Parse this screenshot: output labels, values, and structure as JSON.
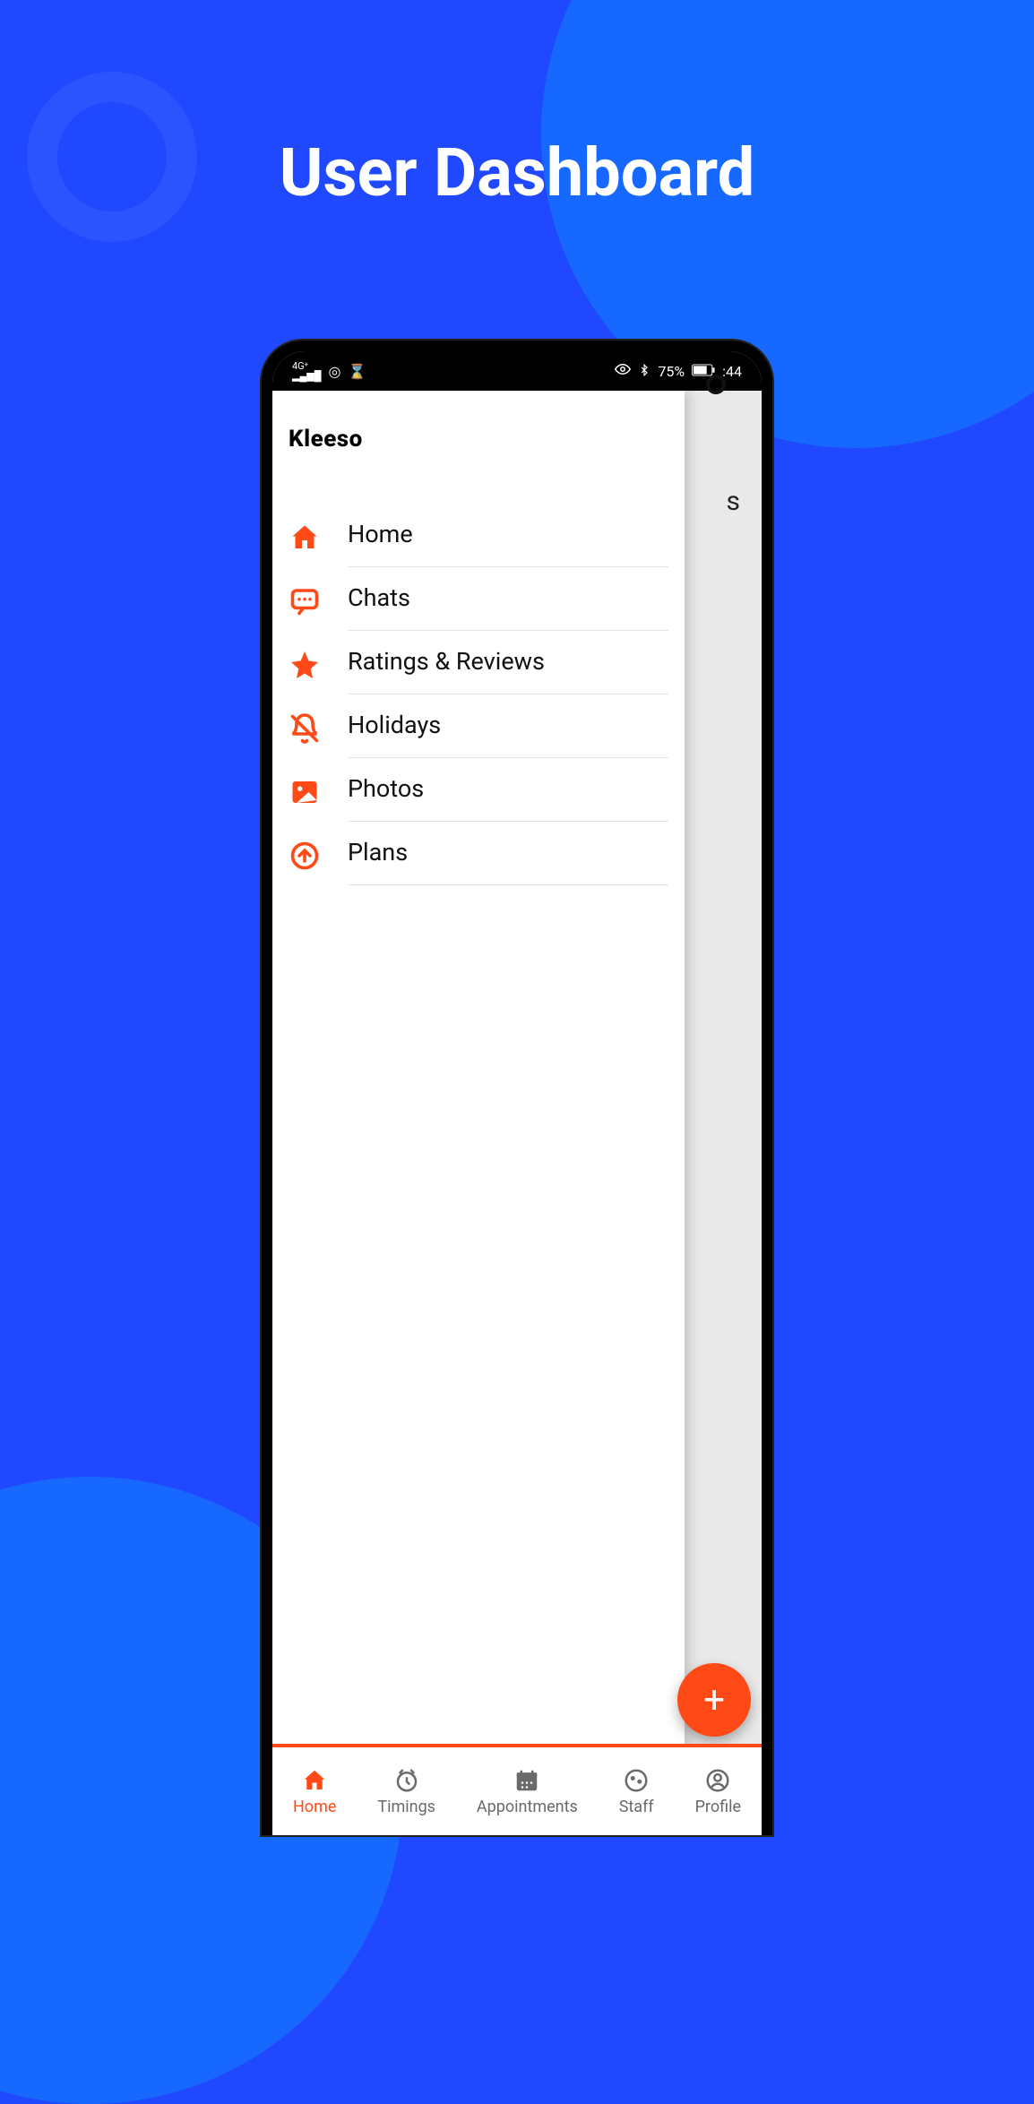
{
  "page": {
    "title": "User Dashboard"
  },
  "status": {
    "signal": "4G",
    "battery_pct": "75%",
    "time": "44",
    "bluetooth": true,
    "eye": true
  },
  "brand": "Kleeso",
  "menu": {
    "items": [
      {
        "label": "Home",
        "icon": "home-icon"
      },
      {
        "label": "Chats",
        "icon": "chat-icon"
      },
      {
        "label": "Ratings & Reviews",
        "icon": "star-icon"
      },
      {
        "label": "Holidays",
        "icon": "bell-off-icon"
      },
      {
        "label": "Photos",
        "icon": "image-icon"
      },
      {
        "label": "Plans",
        "icon": "arrow-up-circle-icon"
      }
    ]
  },
  "peek_text": "s",
  "fab": {
    "symbol": "+"
  },
  "bottom_nav": {
    "items": [
      {
        "label": "Home",
        "active": true
      },
      {
        "label": "Timings",
        "active": false
      },
      {
        "label": "Appointments",
        "active": false
      },
      {
        "label": "Staff",
        "active": false
      },
      {
        "label": "Profile",
        "active": false
      }
    ]
  },
  "colors": {
    "accent": "#ff4a17",
    "bg": "#2049ff"
  }
}
